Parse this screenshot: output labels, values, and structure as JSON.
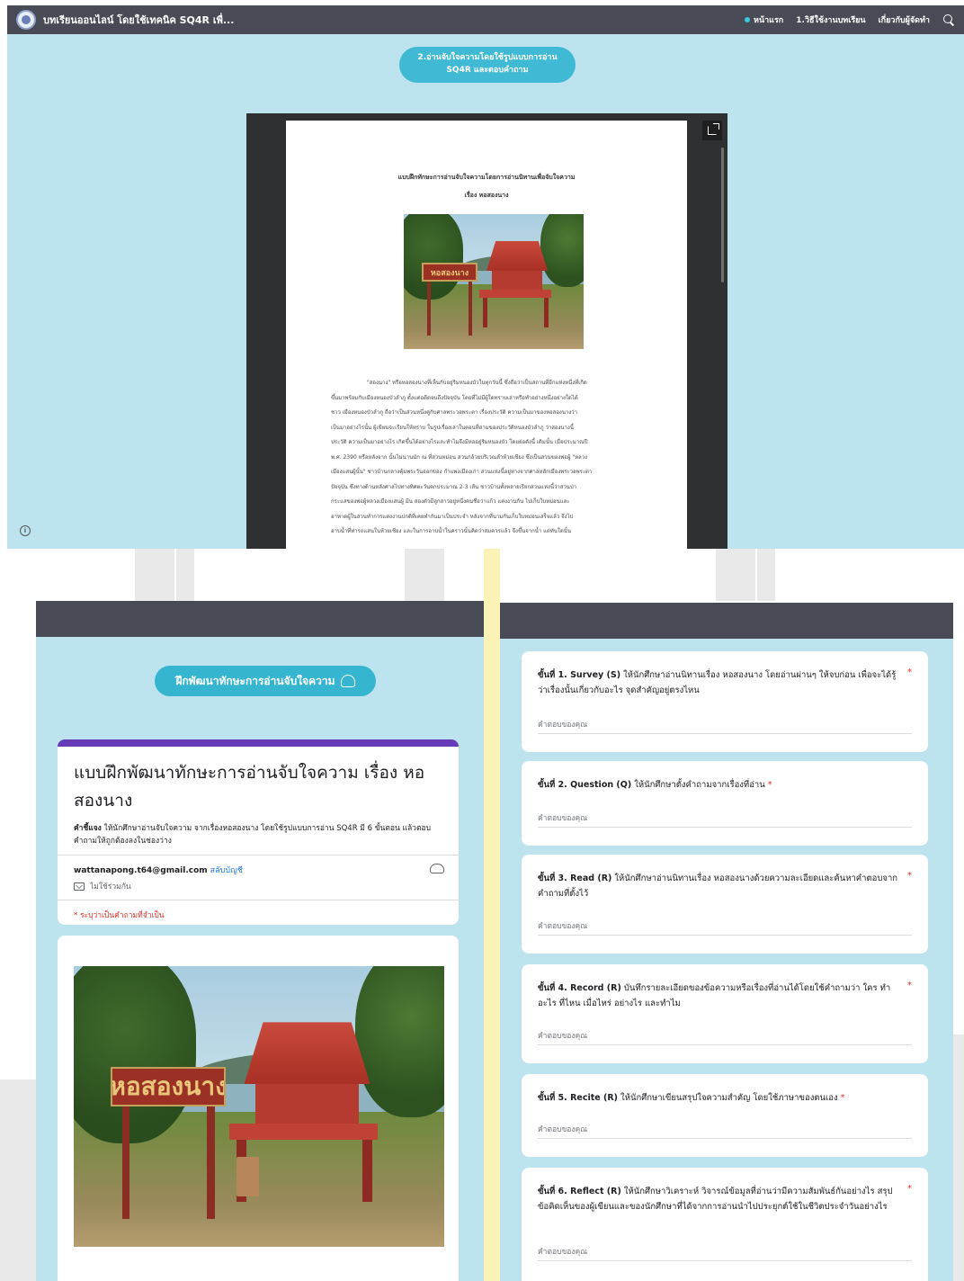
{
  "site": {
    "title": "บทเรียนออนไลน์ โดยใช้เทคนิค SQ4R เพื่...",
    "nav": {
      "home": "หน้าแรก",
      "howto": "1.วิธีใช้งานบทเรียน",
      "about": "เกี่ยวกับผู้จัดทำ"
    },
    "section_pill_line1": "2.อ่านจับใจความโดยใช้รูปแบบการอ่าน",
    "section_pill_line2": "SQ4R และตอบคำถาม",
    "doc": {
      "title_line1": "แบบฝึกทักษะการอ่านจับใจความโดยการอ่านนิทานเพื่อจับใจความ",
      "title_line2": "เรื่อง หอสองนาง",
      "photo_sign": "หอสองนาง",
      "body_lines": [
        "\"สองนาง\" หรือหอสองนางที่เห็นกับอยู่ริมหนองบัวในทุกวันนี้ ซึ่งถือว่าเป็นสถานที่อีกแห่งหนึ่งที่เกิด",
        "ขึ้นมาพร้อมกับเมืองหนองบัวลำภู ตั้งแต่อดีตจนถึงปัจจุบัน โดยที่ไม่มีผู้ใดทราบเล่าหรือทำอย่างหนึ่งอย่างใดได้",
        "ชาว เมืองหนองบัวลำภู ถือว่าเป็นส่วนหนึ่งคู่กับศาลพระวอพระตา เรื่องประวัติ ความเป็นมาของหอสองนางว่า",
        "เป็นมาอย่างไรนั้น ผู้เขียนจะเรียนให้ทราบ ในรูปเรื่องเล่าในตอนที่สามของประวัติหนองบัวลำภู ว่าสองนางนี้",
        "ประวัติ ความเป็นมาอย่างไร เกิดขึ้นได้อย่างไรและทำไมจึงมีหออยู่ริมหนองบัว โดยย่อดังนี้ เดิมนั้น เมื่อประมาณปี",
        "พ.ศ. 2390 หรือหลังจาก นั้นไม่นานนัก ณ ที่สวนหม่อน สวนกล้วยบริเวณลำห้วยเชียง ซึ่งเป็นสวนของพ่อผู้ \"หลวง",
        "เมืองแสนผู้นั้น\" ชาวบ้านกลางคุ้มพระวันออกของ กำแพงเมืองเก่า สวนแห่งนี้อยู่ห่างจากศาลหลักเมืองพระวอพระตา",
        "ปัจจุบัน ซึ่งทางด้านหลังศาลไปทางทิศตะวันตกประมาณ 2-3 เส้น ชาวบ้านทั้งหลายเรียกสวนแห่งนี้ว่าสวนป่า",
        "กระแสของพ่อผู้หลวงเมืองแสนผู้ มีน สองตัวมีลูกสาวอยู่หนึ่งคนชื่อว่าแก้ว แต่งงานกัน ไปเก็บใบหม่อนและ",
        "อาหาดผู้ในสวนทำการแต่งงานปกติที่เคยทำกันมาเป็นประจำ หลังจากที่นามกันเก็บใบหม่อนเสร็จแล้ว จึงไป",
        "อาบน้ำที่ท่ารถแสนในห้วยเชียง และในการอาบน้ำในคราวนั้นคิดว่าสมควรแล้ว จึงขึ้นจากน้ำ แต่ทันใดนั้น"
      ]
    }
  },
  "form": {
    "banner": "ฝึกพัฒนาทักษะการอ่านจับใจความ",
    "title": "แบบฝึกพัฒนาทักษะการอ่านจับใจความ เรื่อง หอสองนาง",
    "desc_label": "คำชี้แจง",
    "desc_text": " ให้นักศึกษาอ่านจับใจความ จากเรื่องหอสองนาง โดยใช้รูปแบบการอ่าน SQ4R มี 6 ขั้นตอน แล้วตอบคำถามให้ถูกต้องลงในช่องว่าง",
    "email": "wattanapong.t64@gmail.com",
    "switch_account": "สลับบัญชี",
    "not_shared": "ไม่ใช้ร่วมกัน",
    "required_note": "* ระบุว่าเป็นคำถามที่จำเป็น",
    "photo_sign": "หอสองนาง",
    "answer_placeholder": "คำตอบของคุณ",
    "questions": [
      {
        "step": "ขั้นที่ 1. Survey (S)",
        "text": " ให้นักศึกษาอ่านนิทานเรื่อง หอสองนาง โดยอ่านผ่านๆ ให้จบก่อน เพื่อจะได้รู้ว่าเรื่องนั้นเกี่ยวกับอะไร จุดสำคัญอยู่ตรงไหน",
        "star": "*"
      },
      {
        "step": "ขั้นที่ 2. Question (Q)",
        "text": " ให้นักศึกษาตั้งคำถามจากเรื่องที่อ่าน",
        "star": "*"
      },
      {
        "step": "ขั้นที่ 3. Read (R)",
        "text": " ให้นักศึกษาอ่านนิทานเรื่อง หอสองนางด้วยความละเอียดและค้นหาคำตอบจากคำถามที่ตั้งไว้",
        "star": "*"
      },
      {
        "step": "ขั้นที่ 4. Record (R)",
        "text": " บันทึกรายละเอียดของข้อความหรือเรื่องที่อ่านได้โดยใช้คำถามว่า ใคร ทำอะไร ที่ไหน เมื่อไหร่ อย่างไร และทำไม",
        "star": "*"
      },
      {
        "step": "ขั้นที่ 5. Recite (R)",
        "text": " ให้นักศึกษาเขียนสรุปใจความสำคัญ โดยใช้ภาษาของตนเอง",
        "star": "*"
      },
      {
        "step": "ขั้นที่ 6. Reflect (R)",
        "text": " ให้นักศึกษาวิเคราะห์ วิจารณ์ข้อมูลที่อ่านว่ามีความสัมพันธ์กันอย่างไร สรุปข้อคิดเห็นของผู้เขียนและของนักศึกษาที่ได้จากการอ่านนำไปประยุกต์ใช้ในชีวิตประจำวันอย่างไร",
        "star": "*"
      }
    ]
  },
  "colors": {
    "nav_bg": "#484b55",
    "site_bg": "#bde3ef",
    "pill": "#40b9d4",
    "form_accent": "#673ab7",
    "required": "#d93025"
  }
}
